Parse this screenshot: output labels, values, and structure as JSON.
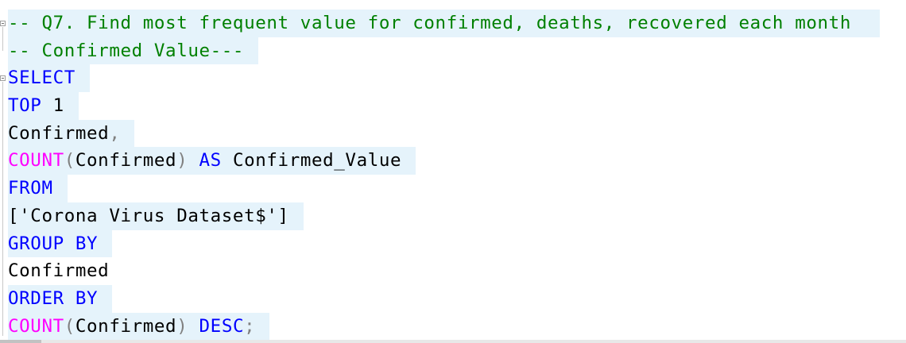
{
  "editor": {
    "language": "sql",
    "lines": [
      {
        "tokens": [
          {
            "t": "-- Q7. Find most frequent value for confirmed, deaths, recovered each month",
            "c": "comment"
          }
        ]
      },
      {
        "tokens": [
          {
            "t": "-- Confirmed Value---",
            "c": "comment"
          }
        ]
      },
      {
        "tokens": [
          {
            "t": "SELECT",
            "c": "kw"
          }
        ]
      },
      {
        "tokens": [
          {
            "t": "TOP",
            "c": "kw"
          },
          {
            "t": " 1",
            "c": "plain"
          }
        ]
      },
      {
        "tokens": [
          {
            "t": "Confirmed",
            "c": "plain"
          },
          {
            "t": ",",
            "c": "gray"
          }
        ]
      },
      {
        "tokens": [
          {
            "t": "COUNT",
            "c": "fn"
          },
          {
            "t": "(",
            "c": "gray"
          },
          {
            "t": "Confirmed",
            "c": "plain"
          },
          {
            "t": ")",
            "c": "gray"
          },
          {
            "t": " ",
            "c": "plain"
          },
          {
            "t": "AS",
            "c": "kw"
          },
          {
            "t": " Confirmed_Value",
            "c": "plain"
          }
        ]
      },
      {
        "tokens": [
          {
            "t": "FROM",
            "c": "kw"
          }
        ]
      },
      {
        "tokens": [
          {
            "t": "['Corona Virus Dataset$']",
            "c": "plain"
          }
        ]
      },
      {
        "tokens": [
          {
            "t": "GROUP BY",
            "c": "kw"
          }
        ]
      },
      {
        "tokens": [
          {
            "t": "Confirmed",
            "c": "plain"
          }
        ]
      },
      {
        "tokens": [
          {
            "t": "ORDER BY",
            "c": "kw"
          }
        ]
      },
      {
        "tokens": [
          {
            "t": "COUNT",
            "c": "fn"
          },
          {
            "t": "(",
            "c": "gray"
          },
          {
            "t": "Confirmed",
            "c": "plain"
          },
          {
            "t": ")",
            "c": "gray"
          },
          {
            "t": " ",
            "c": "plain"
          },
          {
            "t": "DESC",
            "c": "kw"
          },
          {
            "t": ";",
            "c": "gray"
          }
        ]
      }
    ],
    "highlighted_lines": [
      0,
      1,
      2,
      3,
      4,
      5,
      6,
      7,
      8,
      10,
      11
    ],
    "colors": {
      "comment": "#008000",
      "keyword": "#0000ff",
      "function": "#ff00ff",
      "punctuation": "#808080",
      "text": "#000000",
      "selection": "#e5f3fb"
    },
    "gutter_icons": [
      "collapse-region-icon",
      "collapse-region-icon"
    ]
  }
}
